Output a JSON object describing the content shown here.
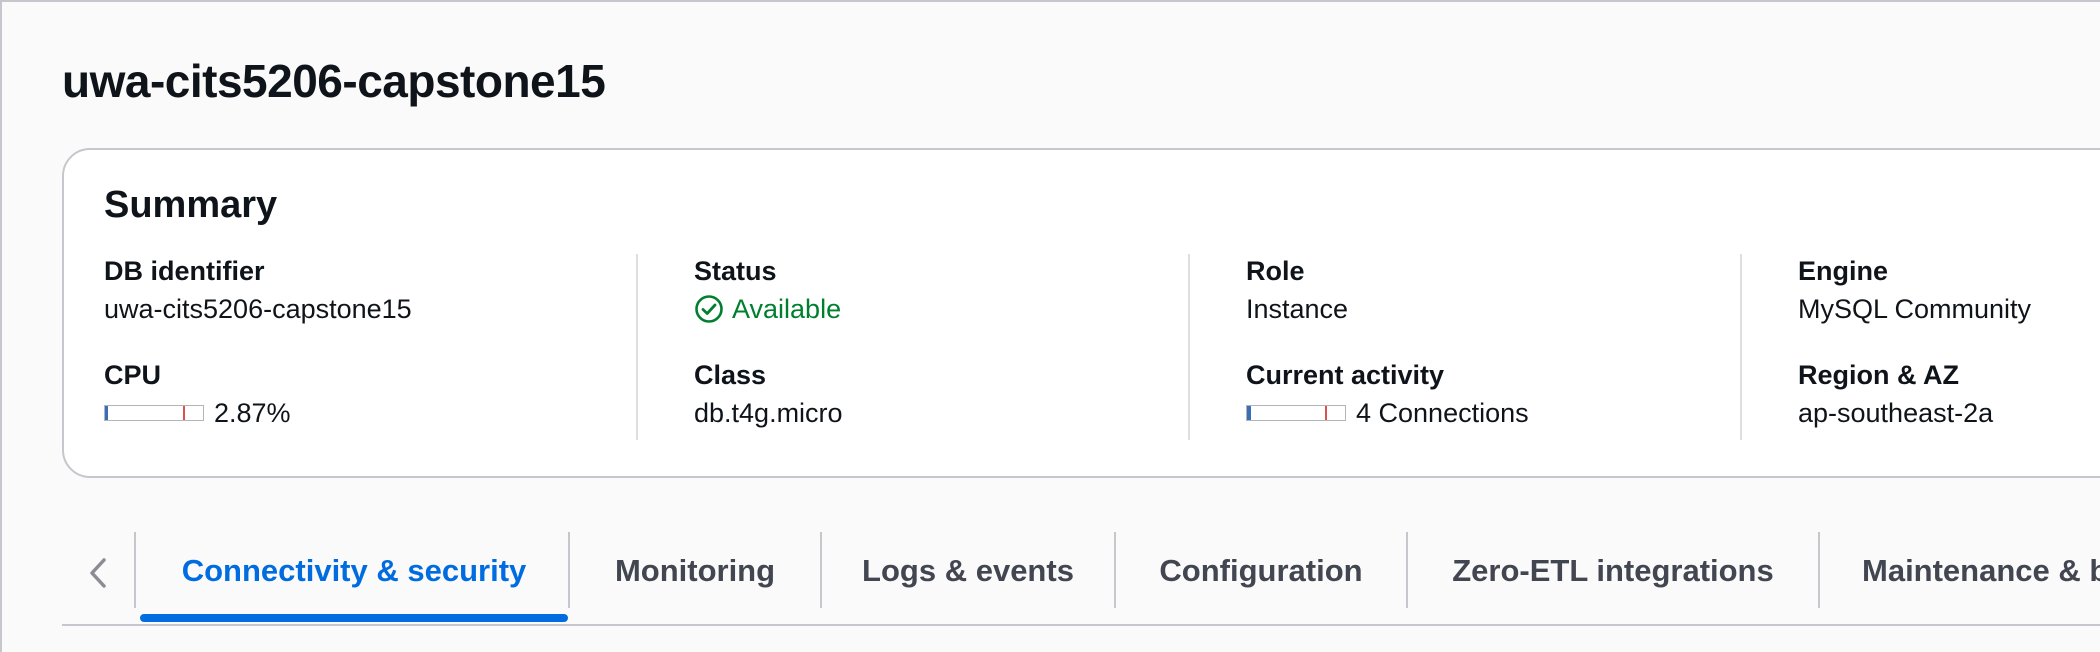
{
  "header": {
    "title": "uwa-cits5206-capstone15"
  },
  "summary": {
    "heading": "Summary",
    "db_identifier": {
      "label": "DB identifier",
      "value": "uwa-cits5206-capstone15"
    },
    "cpu": {
      "label": "CPU",
      "value": "2.87%",
      "level_percent": 2.87
    },
    "status": {
      "label": "Status",
      "value": "Available",
      "icon": "status-check-icon",
      "color": "#00802f"
    },
    "class": {
      "label": "Class",
      "value": "db.t4g.micro"
    },
    "role": {
      "label": "Role",
      "value": "Instance"
    },
    "current_activity": {
      "label": "Current activity",
      "value": "4 Connections",
      "count": 4
    },
    "engine": {
      "label": "Engine",
      "value": "MySQL Community"
    },
    "region_az": {
      "label": "Region & AZ",
      "value": "ap-southeast-2a"
    }
  },
  "tabs": {
    "prev_icon": "chevron-left-icon",
    "active_color": "#006ce0",
    "items": [
      {
        "label": "Connectivity & security",
        "active": true
      },
      {
        "label": "Monitoring",
        "active": false
      },
      {
        "label": "Logs & events",
        "active": false
      },
      {
        "label": "Configuration",
        "active": false
      },
      {
        "label": "Zero-ETL integrations",
        "active": false
      },
      {
        "label": "Maintenance & b",
        "active": false
      }
    ]
  }
}
